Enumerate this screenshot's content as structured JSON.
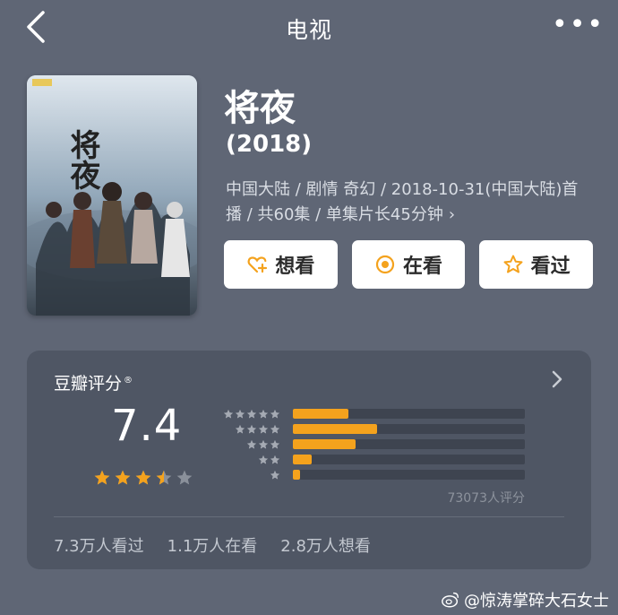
{
  "header": {
    "title": "电视",
    "more_label": "•••"
  },
  "movie": {
    "title": "将夜",
    "year": "(2018)",
    "meta_line": "中国大陆 / 剧情 奇幻 / 2018-10-31(中国大陆)首播 / 共60集 / 单集片长45分钟",
    "meta_chevron": "›",
    "poster_title": "将夜"
  },
  "actions": [
    {
      "label": "想看",
      "icon": "heart-plus-icon"
    },
    {
      "label": "在看",
      "icon": "target-icon"
    },
    {
      "label": "看过",
      "icon": "star-outline-icon"
    }
  ],
  "rating": {
    "title": "豆瓣评分",
    "title_mark": "®",
    "score": "7.4",
    "stars_filled": 3.5,
    "stars_total": 5,
    "distribution": [
      {
        "stars": 5,
        "fraction": 0.24
      },
      {
        "stars": 4,
        "fraction": 0.36
      },
      {
        "stars": 3,
        "fraction": 0.27
      },
      {
        "stars": 2,
        "fraction": 0.08
      },
      {
        "stars": 1,
        "fraction": 0.03
      }
    ],
    "count_label": "73073人评分",
    "stats": [
      "7.3万人看过",
      "1.1万人在看",
      "2.8万人想看"
    ]
  },
  "colors": {
    "accent": "#f4a21d",
    "background": "#5f6675",
    "card": "#4f5664"
  },
  "watermark": {
    "text": "@惊涛掌碎大石女士",
    "icon": "weibo-icon"
  }
}
